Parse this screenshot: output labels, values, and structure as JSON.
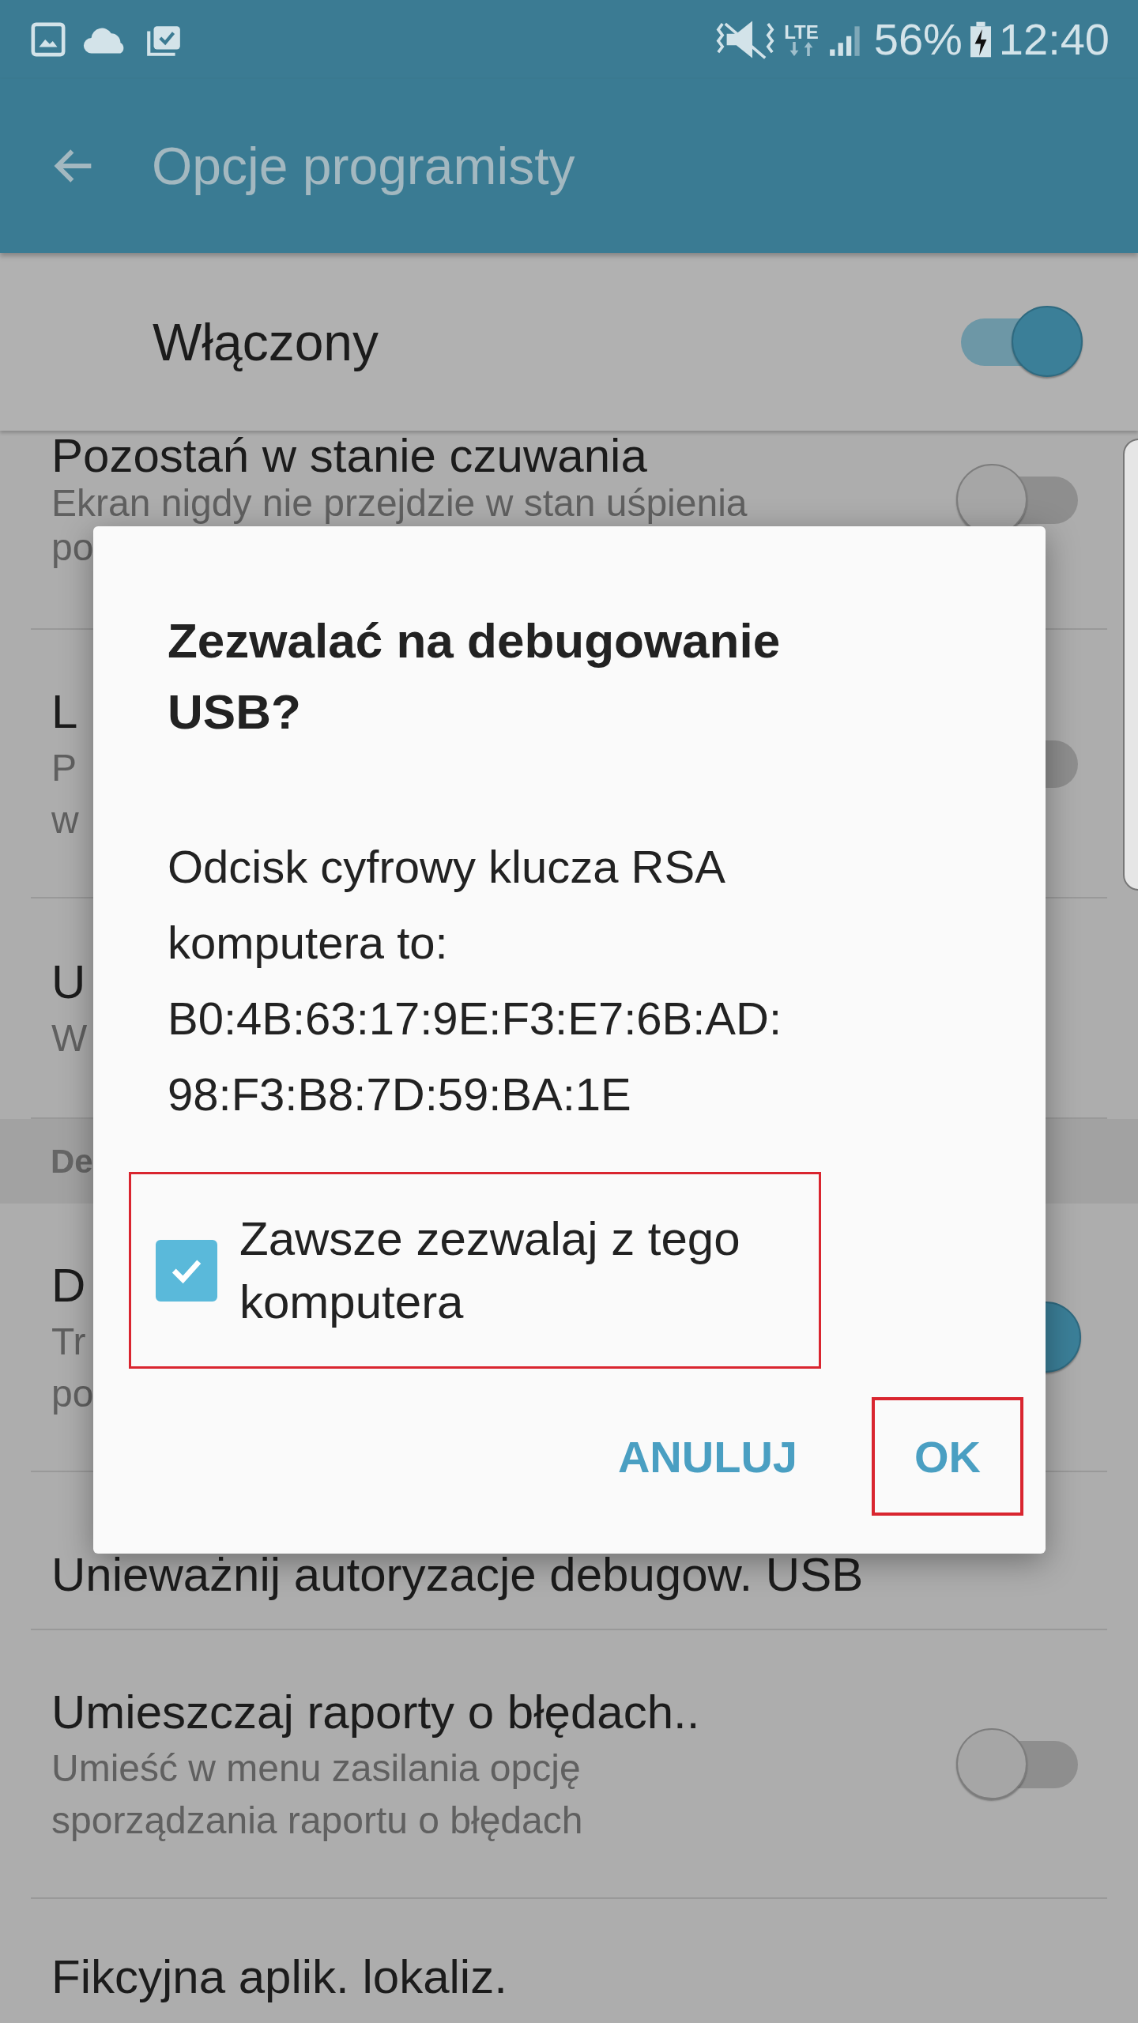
{
  "status_bar": {
    "network": "LTE",
    "battery": "56%",
    "time": "12:40"
  },
  "app_bar": {
    "title": "Opcje programisty"
  },
  "master_switch": {
    "label": "Włączony",
    "on": true
  },
  "settings": [
    {
      "kind": "item",
      "title": "Pozostań w stanie czuwania",
      "subtitle_lines": [
        "Ekran nigdy nie przejdzie w stan uśpienia",
        "po"
      ],
      "toggle": {
        "on": false
      }
    },
    {
      "kind": "item",
      "title": "L",
      "subtitle_lines": [
        "P",
        "w"
      ],
      "toggle": {
        "on": false
      }
    },
    {
      "kind": "item",
      "title": "U",
      "subtitle_lines": [
        "W"
      ]
    },
    {
      "kind": "header",
      "title": "De"
    },
    {
      "kind": "item",
      "title": "D",
      "subtitle_lines": [
        "Tr",
        "po"
      ],
      "toggle": {
        "on": true
      }
    },
    {
      "kind": "item",
      "title": "Unieważnij autoryzacje debugow. USB"
    },
    {
      "kind": "item",
      "title": "Umieszczaj raporty o błędach..",
      "subtitle_lines": [
        "Umieść w menu zasilania opcję",
        "sporządzania raportu o błędach"
      ],
      "toggle": {
        "on": false
      }
    },
    {
      "kind": "item",
      "title": "Fikcyjna aplik. lokaliz."
    }
  ],
  "dialog": {
    "title": "Zezwalać na debugowanie USB?",
    "message": "Odcisk cyfrowy klucza RSA komputera to:",
    "fingerprint_lines": [
      "B0:4B:63:17:9E:F3:E7:6B:AD:",
      "98:F3:B8:7D:59:BA:1E"
    ],
    "checkbox": {
      "label": "Zawsze zezwalaj z tego komputera",
      "checked": true,
      "highlighted": true
    },
    "buttons": [
      {
        "label": "ANULUJ",
        "highlighted": false
      },
      {
        "label": "OK",
        "highlighted": true
      }
    ]
  }
}
